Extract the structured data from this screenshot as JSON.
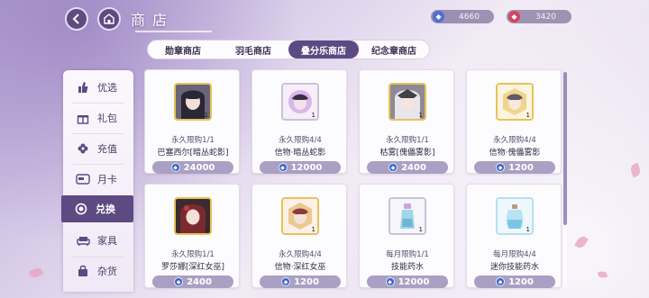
{
  "header": {
    "title": "商店"
  },
  "currencies": [
    {
      "icon": "blue-badge-icon",
      "value": "4660",
      "color": "#4b6fd6"
    },
    {
      "icon": "red-badge-icon",
      "value": "3420",
      "color": "#d6455a"
    }
  ],
  "sidebar": {
    "items": [
      {
        "label": "优选",
        "icon": "thumbs-up-icon"
      },
      {
        "label": "礼包",
        "icon": "gift-icon"
      },
      {
        "label": "充值",
        "icon": "flower-icon"
      },
      {
        "label": "月卡",
        "icon": "vip-card-icon"
      },
      {
        "label": "兑换",
        "icon": "exchange-icon",
        "active": true
      },
      {
        "label": "家具",
        "icon": "sofa-icon"
      },
      {
        "label": "杂货",
        "icon": "bag-icon"
      }
    ]
  },
  "tabs": [
    {
      "label": "勋章商店"
    },
    {
      "label": "羽毛商店"
    },
    {
      "label": "叠分乐商店",
      "active": true
    },
    {
      "label": "纪念章商店"
    }
  ],
  "items": [
    {
      "limit": "永久限购1/1",
      "name": "巴塞西尔[暗丛蛇影]",
      "price": "24000",
      "qty": "1"
    },
    {
      "limit": "永久限购4/4",
      "name": "信物·暗丛蛇影",
      "price": "12000",
      "qty": "1"
    },
    {
      "limit": "永久限购1/1",
      "name": "枯雾[傀儡雾影]",
      "price": "2400",
      "qty": "1"
    },
    {
      "limit": "永久限购4/4",
      "name": "信物·傀儡雾影",
      "price": "1200",
      "qty": "1"
    },
    {
      "limit": "永久限购1/1",
      "name": "罗莎娜[深红女巫]",
      "price": "2400",
      "qty": "1"
    },
    {
      "limit": "永久限购4/4",
      "name": "信物·深红女巫",
      "price": "1200",
      "qty": "1"
    },
    {
      "limit": "每月限购1/1",
      "name": "技能药水",
      "price": "12000",
      "qty": "1"
    },
    {
      "limit": "每月限购4/4",
      "name": "迷你技能药水",
      "price": "1200",
      "qty": "1"
    }
  ],
  "colors": {
    "accent": "#5d4a83",
    "price_pill": "#a9a0c4",
    "gold_frame": "#e7c259"
  }
}
